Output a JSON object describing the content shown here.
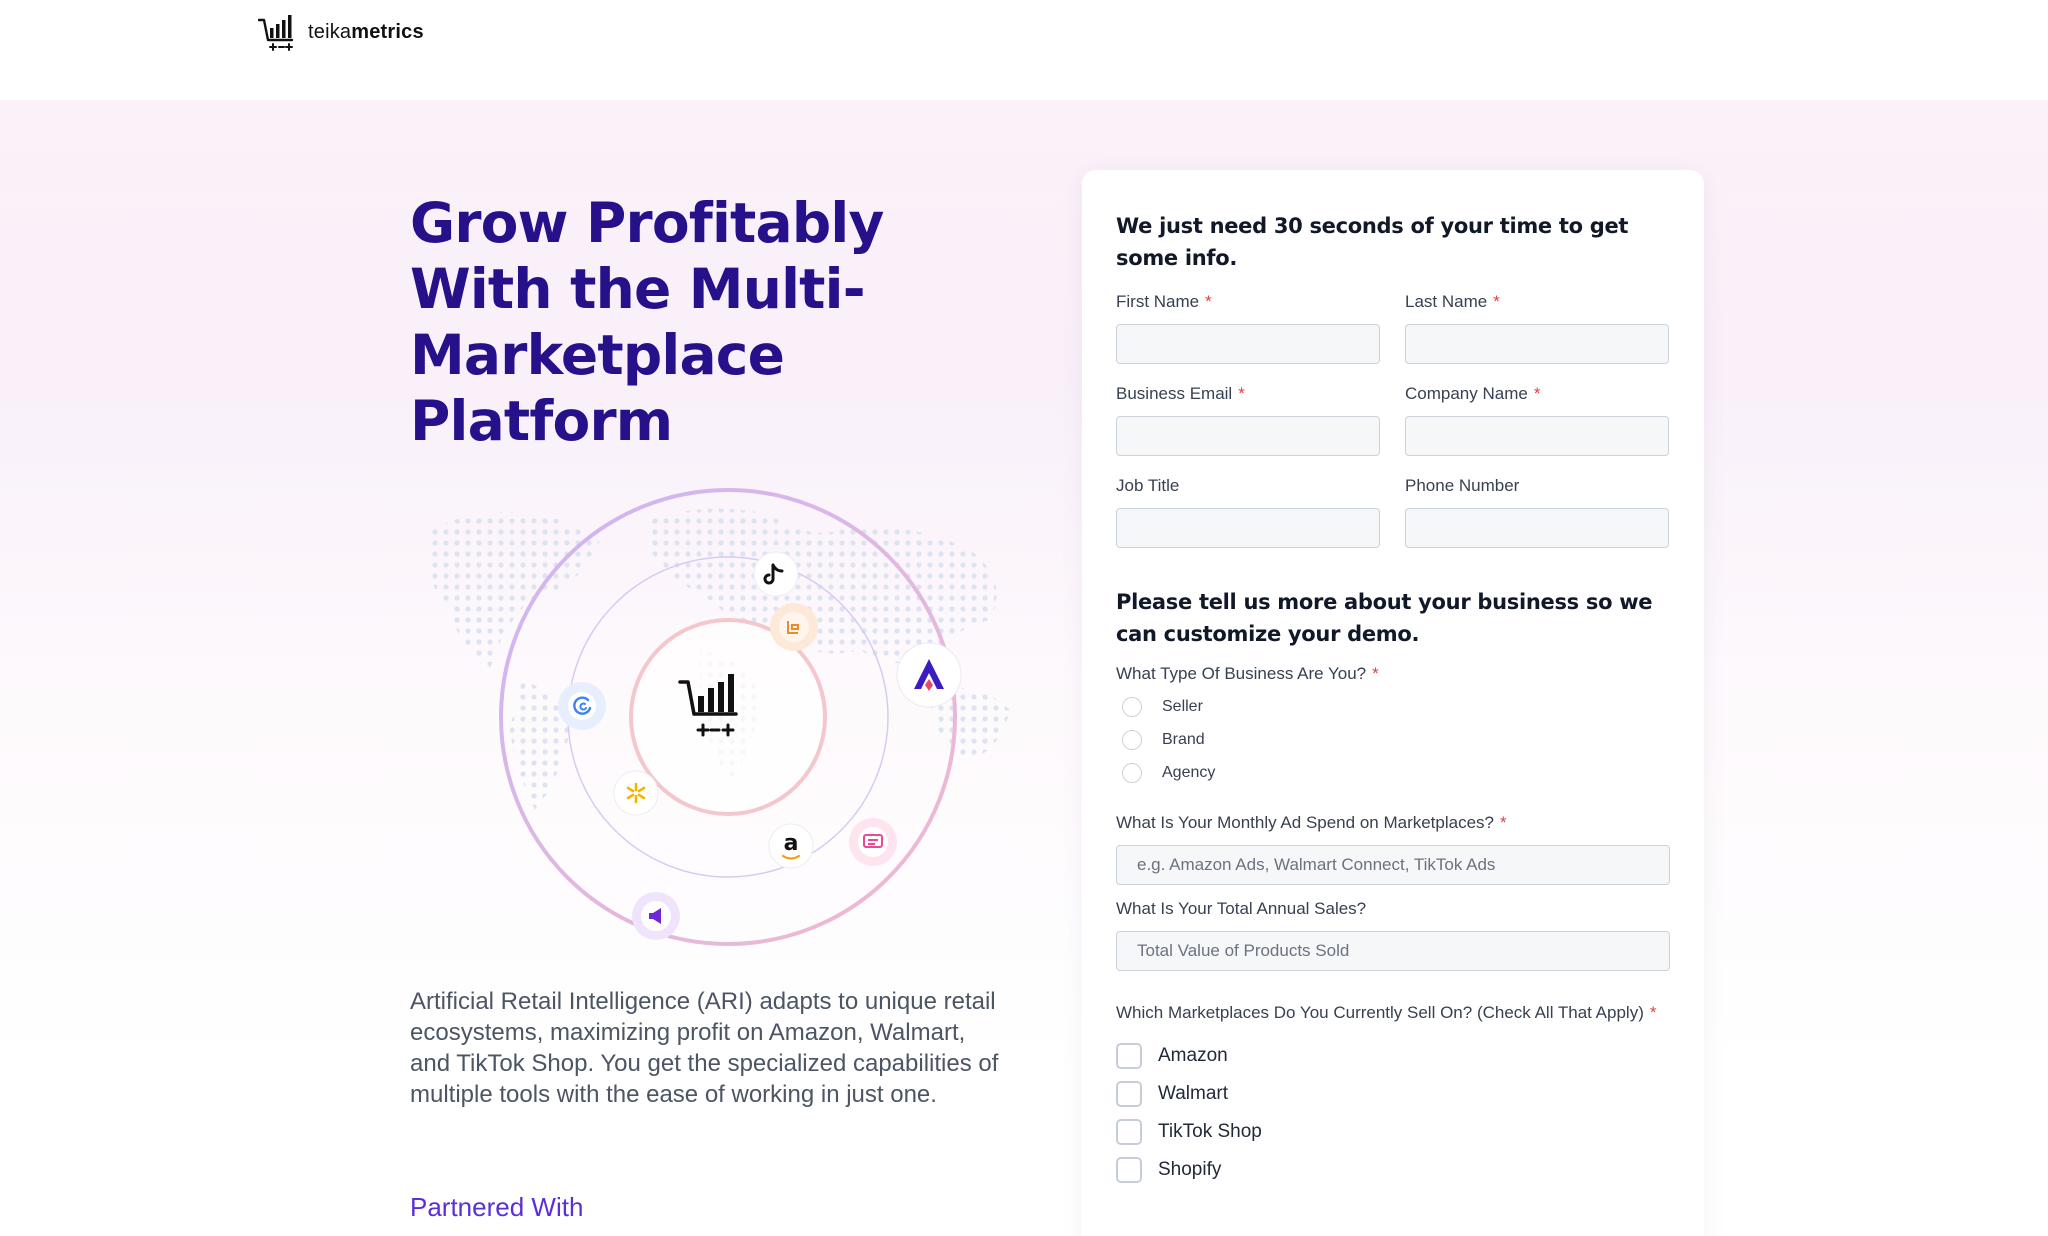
{
  "brand": {
    "name_regular": "teika",
    "name_bold": "metrics",
    "logo_icon": "cart-chart-icon"
  },
  "hero": {
    "title": "Grow Profitably With the Multi-Marketplace Platform",
    "description": "Artificial Retail Intelligence (ARI) adapts to unique retail ecosystems, maximizing profit on Amazon, Walmart, and TikTok Shop. You get the specialized capabilities of multiple tools with the ease of working in just one.",
    "partnered_label": "Partnered With",
    "orbit_icons": [
      "tiktok-icon",
      "amazon-icon",
      "walmart-icon",
      "target-icon",
      "megaphone-icon",
      "ads-icon",
      "shipping-icon",
      "brand-a-icon"
    ]
  },
  "form": {
    "heading": "We just need 30 seconds of your time to get some info.",
    "required_mark": "*",
    "fields": {
      "first_name": "First Name",
      "last_name": "Last Name",
      "business_email": "Business Email",
      "company_name": "Company Name",
      "job_title": "Job Title",
      "phone_number": "Phone Number"
    },
    "section2_heading": "Please tell us more about your business so we can customize your demo.",
    "business_type_label": "What Type Of Business Are You?",
    "business_types": [
      "Seller",
      "Brand",
      "Agency"
    ],
    "ad_spend_label": "What Is Your Monthly Ad Spend on Marketplaces?",
    "ad_spend_placeholder": "e.g. Amazon Ads, Walmart Connect, TikTok Ads",
    "annual_sales_label": "What Is Your Total Annual Sales?",
    "annual_sales_placeholder": "Total Value of Products Sold",
    "marketplaces_label": "Which Marketplaces Do You Currently Sell On? (Check All That Apply)",
    "marketplaces": [
      "Amazon",
      "Walmart",
      "TikTok Shop",
      "Shopify"
    ]
  }
}
